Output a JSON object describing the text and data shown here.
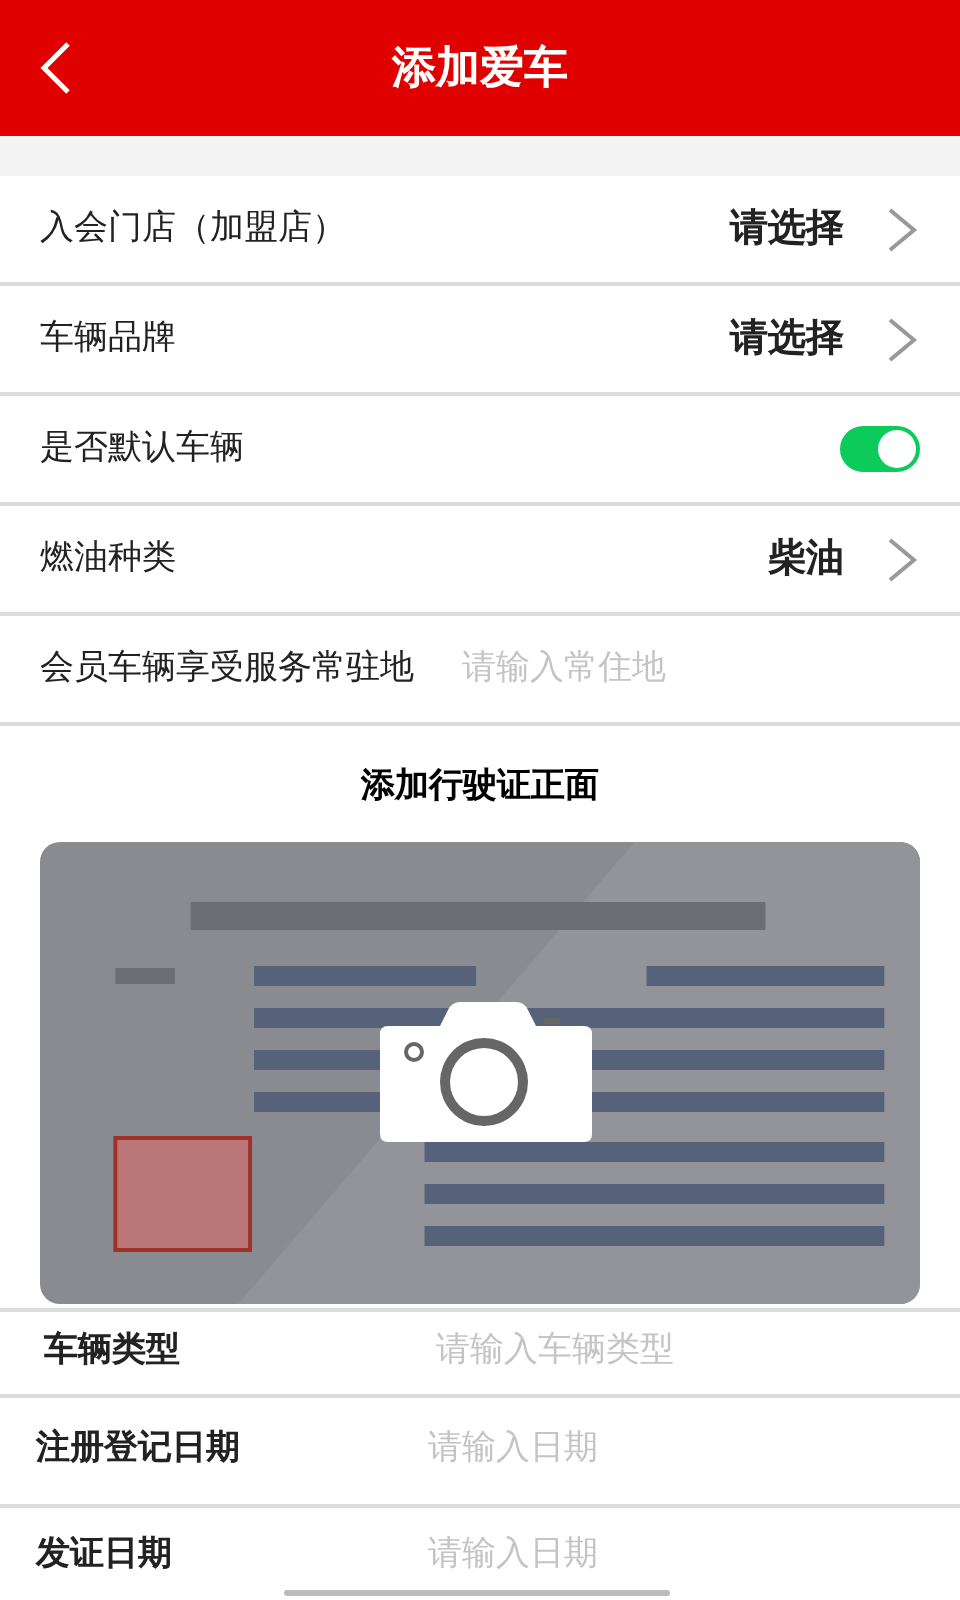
{
  "header": {
    "title": "添加爱车"
  },
  "rows": [
    {
      "kind": "select",
      "label": "入会门店（加盟店）",
      "value": "请选择"
    },
    {
      "kind": "select",
      "label": "车辆品牌",
      "value": "请选择"
    },
    {
      "kind": "toggle",
      "label": "是否默认车辆",
      "on": true
    },
    {
      "kind": "select",
      "label": "燃油种类",
      "value": "柴油"
    },
    {
      "kind": "input",
      "label": "会员车辆享受服务常驻地",
      "placeholder": "请输入常住地"
    }
  ],
  "license": {
    "title": "添加行驶证正面"
  },
  "fields": [
    {
      "label": "车辆类型",
      "placeholder": "请输入车辆类型"
    },
    {
      "label": "注册登记日期",
      "placeholder": "请输入日期"
    },
    {
      "label": "发证日期",
      "placeholder": "请输入日期"
    }
  ]
}
